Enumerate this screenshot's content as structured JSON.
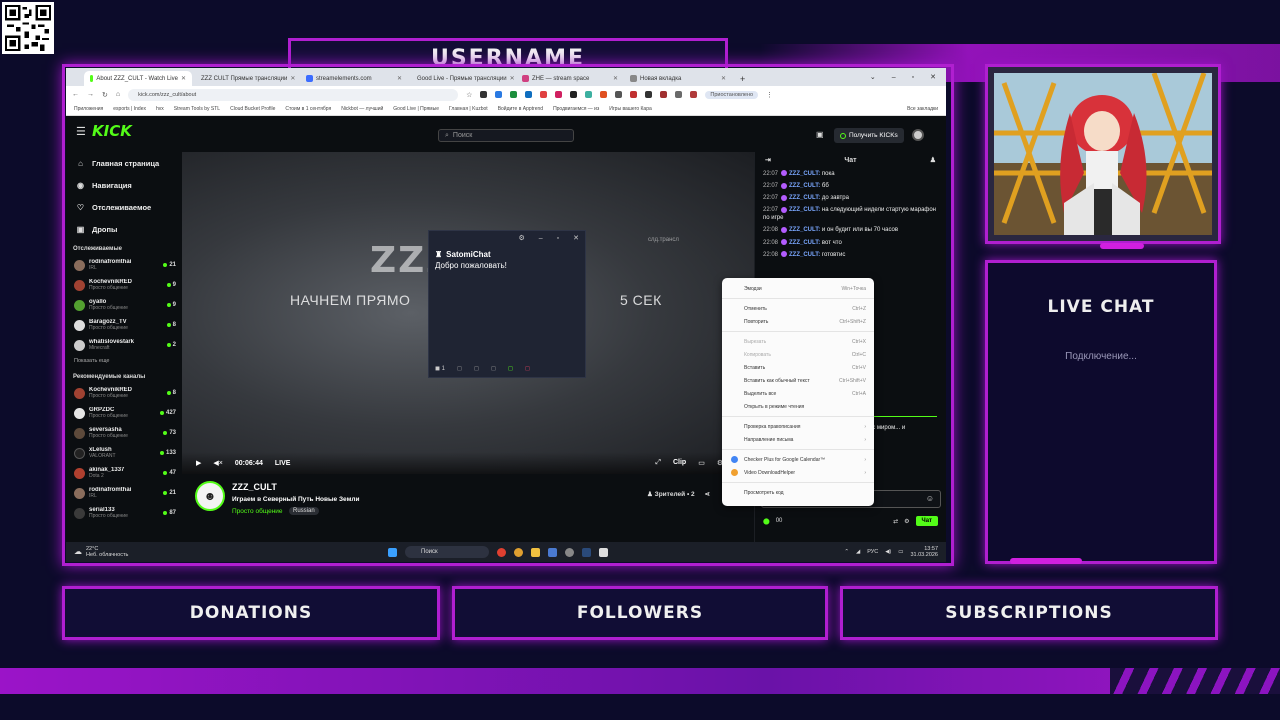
{
  "overlay": {
    "username": "USERNAME",
    "live_chat_title": "LIVE CHAT",
    "live_chat_status": "Подключение...",
    "donations": "DONATIONS",
    "followers": "FOLLOWERS",
    "subscriptions": "SUBSCRIPTIONS"
  },
  "browser": {
    "tabs": [
      {
        "label": "About ZZZ_CULT - Watch Live",
        "active": true
      },
      {
        "label": "ZZZ CULT Прямые трансляции",
        "active": false
      },
      {
        "label": "streamelements.com",
        "active": false
      },
      {
        "label": "Good Live - Прямые трансляции",
        "active": false
      },
      {
        "label": "ZHE — stream space",
        "active": false
      },
      {
        "label": "Новая вкладка",
        "active": false
      }
    ],
    "new_tab": "+",
    "url": "kick.com/zzz_cult/about",
    "chrome_pill": "Приостановлено",
    "bookmarks": [
      "Приложения",
      "esports | Index",
      "hvx",
      "Stream Tools by STL",
      "Cloud Bucket Profile",
      "Стоим в 1 сентября",
      "Nickbot — лучший",
      "Good Live | Прямые",
      "Главная | Kuzbot",
      "Войдите в Apptrend",
      "Продвигаемся — из",
      "Игры вашего Кара",
      "Все закладки"
    ]
  },
  "kick": {
    "logo": "KICK",
    "search_placeholder": "Поиск",
    "get_kicks": "Получить KICKs",
    "nav": [
      {
        "label": "Главная страница",
        "icon": "home-icon",
        "glyph": "⌂"
      },
      {
        "label": "Навигация",
        "icon": "compass-icon",
        "glyph": "◉"
      },
      {
        "label": "Отслеживаемое",
        "icon": "heart-icon",
        "glyph": "♡"
      },
      {
        "label": "Дропы",
        "icon": "gift-icon",
        "glyph": "▣"
      }
    ],
    "following_title": "Отслеживаемые",
    "following": [
      {
        "name": "rodinafromthai",
        "cat": "IRL",
        "viewers": "21",
        "color": "#8a6d5c"
      },
      {
        "name": "KochevnikRED",
        "cat": "Просто общение",
        "viewers": "9",
        "color": "#a04232"
      },
      {
        "name": "oyallo",
        "cat": "Просто общение",
        "viewers": "9",
        "color": "#53a030"
      },
      {
        "name": "Baragozz_TV",
        "cat": "Просто общение",
        "viewers": "8",
        "color": "#ddd"
      },
      {
        "name": "whatislovestark",
        "cat": "Minecraft",
        "viewers": "2",
        "color": "#ccc"
      }
    ],
    "show_more": "Показать еще",
    "recommended_title": "Рекомендуемые каналы",
    "recommended": [
      {
        "name": "KochevnikRED",
        "cat": "Просто общение",
        "viewers": "8",
        "color": "#a04232"
      },
      {
        "name": "GRPZDC",
        "cat": "Просто общение",
        "viewers": "427",
        "color": "#e5e5e5"
      },
      {
        "name": "seversasha",
        "cat": "Просто общение",
        "viewers": "73",
        "color": "#5d4a3b"
      },
      {
        "name": "xLelush",
        "cat": "VALORANT",
        "viewers": "133",
        "color": "#222"
      },
      {
        "name": "akinak_1337",
        "cat": "Dota 2",
        "viewers": "47",
        "color": "#b0402f"
      },
      {
        "name": "rodinafromthai",
        "cat": "IRL",
        "viewers": "21",
        "color": "#8a6d5c"
      },
      {
        "name": "serial133",
        "cat": "Просто общение",
        "viewers": "87",
        "color": "#3a3a3a"
      }
    ],
    "video": {
      "title_partial": "ZZZ",
      "subtitle_left": "НАЧНЕМ ПРЯМО",
      "subtitle_right": "5 СЕК",
      "watermark": "слд.трансл",
      "time": "00:06:44",
      "live": "LIVE",
      "clip": "Clip"
    },
    "stream": {
      "name": "ZZZ_CULT",
      "title": "Играем в Северный Путь Новые Земли",
      "category": "Просто общение",
      "tag": "Russian",
      "viewers": "Зрителей • 2"
    },
    "chat": {
      "header": "Чат",
      "messages": [
        {
          "time": "22:07",
          "user": "ZZZ_CULT:",
          "text": "пока"
        },
        {
          "time": "22:07",
          "user": "ZZZ_CULT:",
          "text": "бб"
        },
        {
          "time": "22:07",
          "user": "ZZZ_CULT:",
          "text": "до завтра"
        },
        {
          "time": "22:07",
          "user": "ZZZ_CULT:",
          "text": "на следующий нидели стартую марафон по игре"
        },
        {
          "time": "22:08",
          "user": "ZZZ_CULT:",
          "text": "и он будит или вы 70 часов"
        },
        {
          "time": "22:08",
          "user": "ZZZ_CULT:",
          "text": "вот что"
        },
        {
          "time": "22:08",
          "user": "ZZZ_CULT:",
          "text": "готовтис"
        }
      ],
      "partial_message": "здесь с миром... и",
      "send": "Чат",
      "points": "00"
    }
  },
  "context_menu": [
    {
      "label": "Эмодзи",
      "key": "Win+Точка",
      "disabled": false
    },
    "sep",
    {
      "label": "Отменить",
      "key": "Ctrl+Z",
      "disabled": false
    },
    {
      "label": "Повторить",
      "key": "Ctrl+Shift+Z",
      "disabled": false
    },
    "sep",
    {
      "label": "Вырезать",
      "key": "Ctrl+X",
      "disabled": true
    },
    {
      "label": "Копировать",
      "key": "Ctrl+C",
      "disabled": true
    },
    {
      "label": "Вставить",
      "key": "Ctrl+V",
      "disabled": false
    },
    {
      "label": "Вставить как обычный текст",
      "key": "Ctrl+Shift+V",
      "disabled": false
    },
    {
      "label": "Выделить все",
      "key": "Ctrl+A",
      "disabled": false
    },
    {
      "label": "Открыть в режиме чтения",
      "key": "",
      "disabled": false
    },
    "sep",
    {
      "label": "Проверка правописания",
      "key": "›",
      "disabled": false
    },
    {
      "label": "Направление письма",
      "key": "›",
      "disabled": false
    },
    "sep",
    {
      "label": "Checker Plus for Google Calendar™",
      "key": "›",
      "disabled": false,
      "icon": "#4285f4"
    },
    {
      "label": "Video DownloadHelper",
      "key": "›",
      "disabled": false,
      "icon": "#f0a030"
    },
    "sep",
    {
      "label": "Просмотреть код",
      "key": "",
      "disabled": false
    }
  ],
  "satomi": {
    "name": "SatomiChat",
    "message": "Добро пожаловать!",
    "count": "1"
  },
  "taskbar": {
    "weather_temp": "22°C",
    "weather_desc": "Неб. облачность",
    "search": "Поиск",
    "lang": "РУС",
    "time": "13:57",
    "date": "31.03.2026"
  }
}
